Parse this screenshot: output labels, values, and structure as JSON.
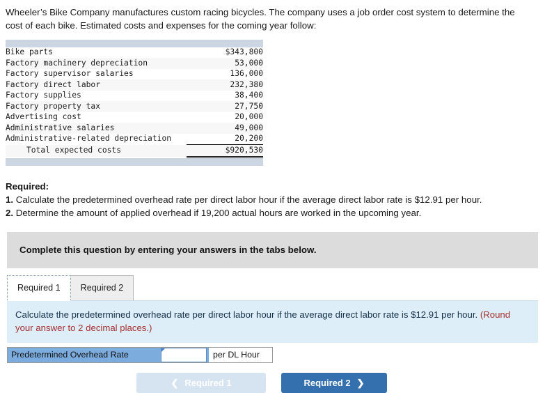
{
  "intro": {
    "text": "Wheeler’s Bike Company manufactures custom racing bicycles. The company uses a job order cost system to determine the cost of each bike. Estimated costs and expenses for the coming year follow:"
  },
  "cost_table": {
    "rows": [
      {
        "label": "Bike parts",
        "amount": "$343,800"
      },
      {
        "label": "Factory machinery depreciation",
        "amount": "53,000"
      },
      {
        "label": "Factory supervisor salaries",
        "amount": "136,000"
      },
      {
        "label": "Factory direct labor",
        "amount": "232,380"
      },
      {
        "label": "Factory supplies",
        "amount": "38,400"
      },
      {
        "label": "Factory property tax",
        "amount": "27,750"
      },
      {
        "label": "Advertising cost",
        "amount": "20,000"
      },
      {
        "label": "Administrative salaries",
        "amount": "49,000"
      },
      {
        "label": "Administrative-related depreciation",
        "amount": "20,200"
      }
    ],
    "total": {
      "label": "Total expected costs",
      "amount": "$920,530"
    }
  },
  "required": {
    "heading": "Required:",
    "item1_num": "1.",
    "item1_text": "Calculate the predetermined overhead rate per direct labor hour if the average direct labor rate is $12.91 per hour.",
    "item2_num": "2.",
    "item2_text": "Determine the amount of applied overhead if 19,200 actual hours are worked in the upcoming year."
  },
  "instruction_banner": {
    "text": "Complete this question by entering your answers in the tabs below."
  },
  "tabs": [
    {
      "label": "Required 1",
      "active": true
    },
    {
      "label": "Required 2",
      "active": false
    }
  ],
  "question_panel": {
    "text": "Calculate the predetermined overhead rate per direct labor hour if the average direct labor rate is $12.91 per hour. ",
    "hint": "(Round your answer to 2 decimal places.)"
  },
  "answer_row": {
    "label": "Predetermined Overhead Rate",
    "value": "",
    "placeholder": "",
    "unit": "per DL Hour"
  },
  "nav": {
    "prev_label": "Required 1",
    "prev_icon": "chevron-left-icon",
    "next_label": "Required 2",
    "next_icon": "chevron-right-icon"
  },
  "colors": {
    "accent_blue": "#3470ae",
    "disabled_blue": "#d6e3f1",
    "panel_blue": "#ddeef8",
    "label_blue": "#7cacdd",
    "hint_red": "#a53030",
    "banner_gray": "#dcdcdc",
    "table_bar": "#ccd5e2"
  }
}
